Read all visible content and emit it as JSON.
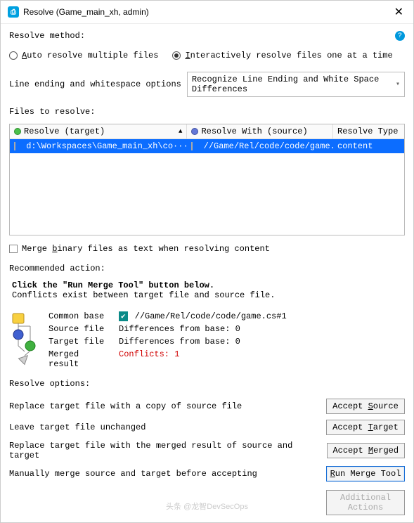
{
  "titlebar": {
    "title": "Resolve (Game_main_xh,                  admin)"
  },
  "method": {
    "label": "Resolve method:",
    "auto": "Auto resolve multiple files",
    "interactive": "Interactively resolve files one at a time",
    "selected": "interactive"
  },
  "lineending": {
    "label": "Line ending and whitespace options",
    "selected": "Recognize Line Ending and White Space Differences"
  },
  "files": {
    "label": "Files to resolve:",
    "cols": {
      "c1": "Resolve (target)",
      "c2": "Resolve With (source)",
      "c3": "Resolve Type"
    },
    "row": {
      "target": "d:\\Workspaces\\Game_main_xh\\co···",
      "source": "//Game/Rel/code/code/game.cs ···",
      "type": "content"
    }
  },
  "mergeBinary": "Merge binary files as text when resolving content",
  "recommended": {
    "label": "Recommended action:",
    "bold": "Click the \"Run Merge Tool\" button below.",
    "sub": "Conflicts exist between target file and source file."
  },
  "mergeinfo": {
    "common_label": "Common base",
    "common_value": "//Game/Rel/code/code/game.cs#1",
    "source_label": "Source file",
    "source_value": "Differences from base: 0",
    "target_label": "Target file",
    "target_value": "Differences from base: 0",
    "merged_label": "Merged result",
    "merged_value": "Conflicts: 1"
  },
  "options": {
    "label": "Resolve options:",
    "r1_text": "Replace target file with a copy of source file",
    "r1_btn": "Accept Source",
    "r2_text": "Leave target file unchanged",
    "r2_btn": "Accept Target",
    "r3_text": "Replace target file with the merged result of source and target",
    "r3_btn": "Accept Merged",
    "r4_text": "Manually merge source and target before accepting",
    "r4_btn": "Run Merge Tool",
    "additional": "Additional Actions"
  },
  "watermark": "头条 @龙智DevSecOps"
}
